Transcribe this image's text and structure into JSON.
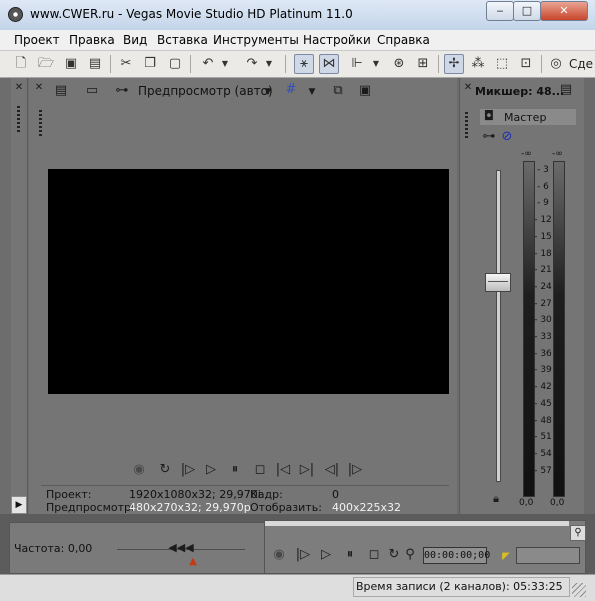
{
  "window": {
    "title": "www.CWER.ru - Vegas Movie Studio HD Platinum 11.0",
    "minimize": "‒",
    "maximize": "□",
    "close": "✕"
  },
  "menu": [
    "Проект",
    "Правка",
    "Вид",
    "Вставка",
    "Инструменты",
    "Настройки",
    "Справка"
  ],
  "toolbar": {
    "overflow_label": "Сде"
  },
  "preview": {
    "mode_label": "Предпросмотр (авто)",
    "info": {
      "project_label": "Проект:",
      "project_value": "1920x1080x32; 29,970i",
      "frame_label": "Кадр:",
      "frame_value": "0",
      "preview_label": "Предпросмотр:",
      "preview_value": "480x270x32; 29,970p",
      "display_label": "Отобразить:",
      "display_value": "400x225x32"
    }
  },
  "mixer": {
    "title": "Микшер: 48...",
    "channel": "Мастер",
    "peak_left": "-∞",
    "peak_right": "-∞",
    "scale": [
      "3",
      "6",
      "9",
      "12",
      "15",
      "18",
      "21",
      "24",
      "27",
      "30",
      "33",
      "36",
      "39",
      "42",
      "45",
      "48",
      "51",
      "54",
      "57"
    ],
    "readout_left": "0,0",
    "readout_right": "0,0"
  },
  "trimmer": {
    "rate_label": "Частота: 0,00"
  },
  "transport": {
    "timecode": "00:00:00;00"
  },
  "statusbar": {
    "record_time": "Время записи (2 каналов): 05:33:25"
  }
}
